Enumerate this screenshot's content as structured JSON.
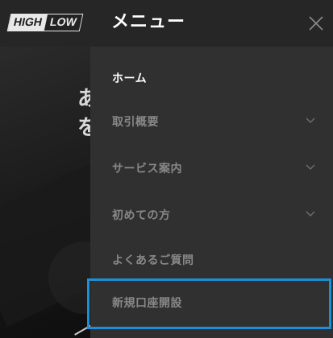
{
  "header": {
    "logo": {
      "high": "HIGH",
      "low": "LOW"
    }
  },
  "hero": {
    "line1": "あ",
    "line2": "を"
  },
  "menu": {
    "title": "メニュー",
    "close_icon": "close-icon",
    "items": [
      {
        "label": "ホーム",
        "has_chevron": false,
        "active": true
      },
      {
        "label": "取引概要",
        "has_chevron": true,
        "active": false
      },
      {
        "label": "サービス案内",
        "has_chevron": true,
        "active": false
      },
      {
        "label": "初めての方",
        "has_chevron": true,
        "active": false
      },
      {
        "label": "よくあるご質問",
        "has_chevron": false,
        "active": false
      },
      {
        "label": "新規口座開設",
        "has_chevron": false,
        "active": false,
        "highlighted": true
      }
    ]
  },
  "colors": {
    "menu_bg": "#303030",
    "header_bg": "#262626",
    "active_text": "#ffffff",
    "inactive_text": "#888888",
    "highlight_border": "#1d8fd6"
  }
}
